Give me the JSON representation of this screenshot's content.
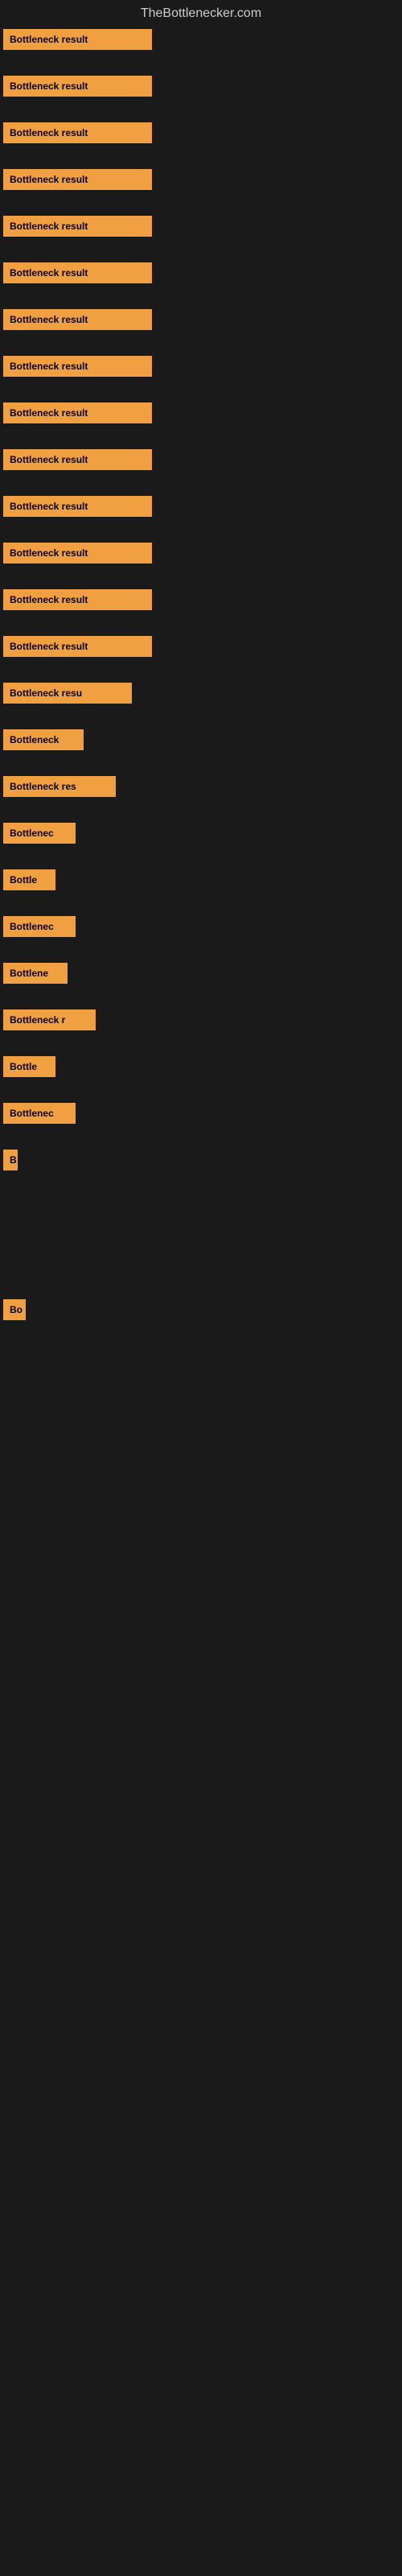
{
  "site": {
    "title": "TheBottlenecker.com"
  },
  "rows": [
    {
      "label": "Bottleneck result",
      "width": 185
    },
    {
      "label": "Bottleneck result",
      "width": 185
    },
    {
      "label": "Bottleneck result",
      "width": 185
    },
    {
      "label": "Bottleneck result",
      "width": 185
    },
    {
      "label": "Bottleneck result",
      "width": 185
    },
    {
      "label": "Bottleneck result",
      "width": 185
    },
    {
      "label": "Bottleneck result",
      "width": 185
    },
    {
      "label": "Bottleneck result",
      "width": 185
    },
    {
      "label": "Bottleneck result",
      "width": 185
    },
    {
      "label": "Bottleneck result",
      "width": 185
    },
    {
      "label": "Bottleneck result",
      "width": 185
    },
    {
      "label": "Bottleneck result",
      "width": 185
    },
    {
      "label": "Bottleneck result",
      "width": 185
    },
    {
      "label": "Bottleneck result",
      "width": 185
    },
    {
      "label": "Bottleneck resu",
      "width": 160
    },
    {
      "label": "Bottleneck",
      "width": 100
    },
    {
      "label": "Bottleneck res",
      "width": 140
    },
    {
      "label": "Bottlenec",
      "width": 90
    },
    {
      "label": "Bottle",
      "width": 65
    },
    {
      "label": "Bottlenec",
      "width": 90
    },
    {
      "label": "Bottlene",
      "width": 80
    },
    {
      "label": "Bottleneck r",
      "width": 115
    },
    {
      "label": "Bottle",
      "width": 65
    },
    {
      "label": "Bottlenec",
      "width": 90
    },
    {
      "label": "B",
      "width": 18
    },
    {
      "label": "",
      "width": 0
    },
    {
      "label": "",
      "width": 0
    },
    {
      "label": "",
      "width": 0
    },
    {
      "label": "",
      "width": 0
    },
    {
      "label": "Bo",
      "width": 28
    },
    {
      "label": "",
      "width": 0
    },
    {
      "label": "",
      "width": 0
    },
    {
      "label": "",
      "width": 0
    },
    {
      "label": "",
      "width": 0
    },
    {
      "label": "",
      "width": 0
    }
  ]
}
